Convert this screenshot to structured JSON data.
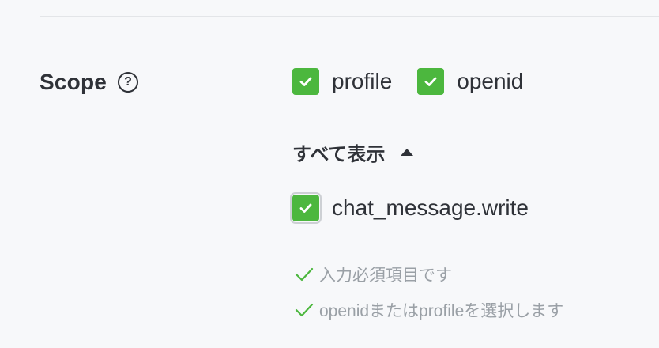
{
  "scope": {
    "label": "Scope",
    "help_icon_glyph": "?",
    "primary_options": [
      {
        "label": "profile",
        "checked": true
      },
      {
        "label": "openid",
        "checked": true
      }
    ],
    "show_all": {
      "label": "すべて表示",
      "expanded": true
    },
    "extra_options": [
      {
        "label": "chat_message.write",
        "checked": true
      }
    ],
    "validations": [
      {
        "text": "入力必須項目です",
        "status": "ok"
      },
      {
        "text": "openidまたはprofileを選択します",
        "status": "ok"
      }
    ]
  },
  "colors": {
    "checkbox_green": "#4cb73e",
    "validation_green": "#4cb73e",
    "text_dark": "#2f3238",
    "text_muted": "#9aa0a6",
    "background": "#f7f8fa"
  },
  "icons": {
    "help": "question-circle-icon",
    "checkbox_mark": "check-icon",
    "expand_toggle": "caret-up-icon",
    "validation_mark": "check-icon"
  }
}
